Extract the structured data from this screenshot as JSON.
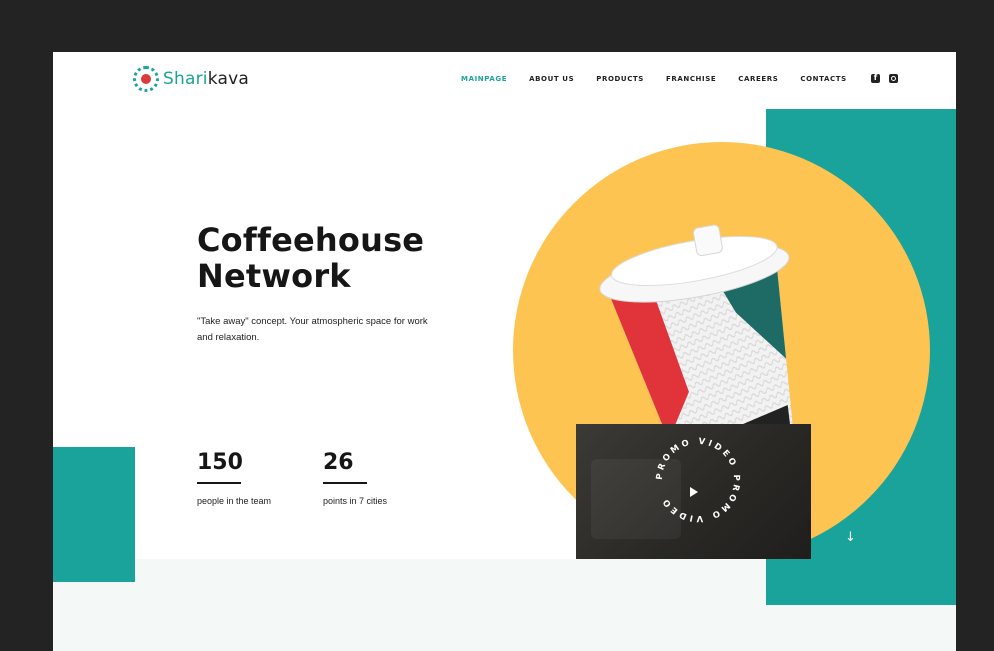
{
  "brand": {
    "name_part1": "Shari",
    "name_part2": "kava"
  },
  "nav": {
    "items": [
      "MAINPAGE",
      "ABOUT US",
      "PRODUCTS",
      "FRANCHISE",
      "CAREERS",
      "CONTACTS"
    ],
    "active": "MAINPAGE",
    "social": [
      "facebook-icon",
      "instagram-icon"
    ]
  },
  "hero": {
    "title_line1": "Coffeehouse",
    "title_line2": "Network",
    "subtitle": "\"Take away\" concept. Your atmospheric space for work and relaxation."
  },
  "stats": [
    {
      "value": "150",
      "label": "people in the team"
    },
    {
      "value": "26",
      "label": "points in 7 cities"
    }
  ],
  "video": {
    "ring_text": "PROMO VIDEO PROMO VIDEO"
  },
  "colors": {
    "accent": "#1aa39a",
    "yellow": "#fdc452",
    "dark": "#232323",
    "red": "#e0343a"
  }
}
